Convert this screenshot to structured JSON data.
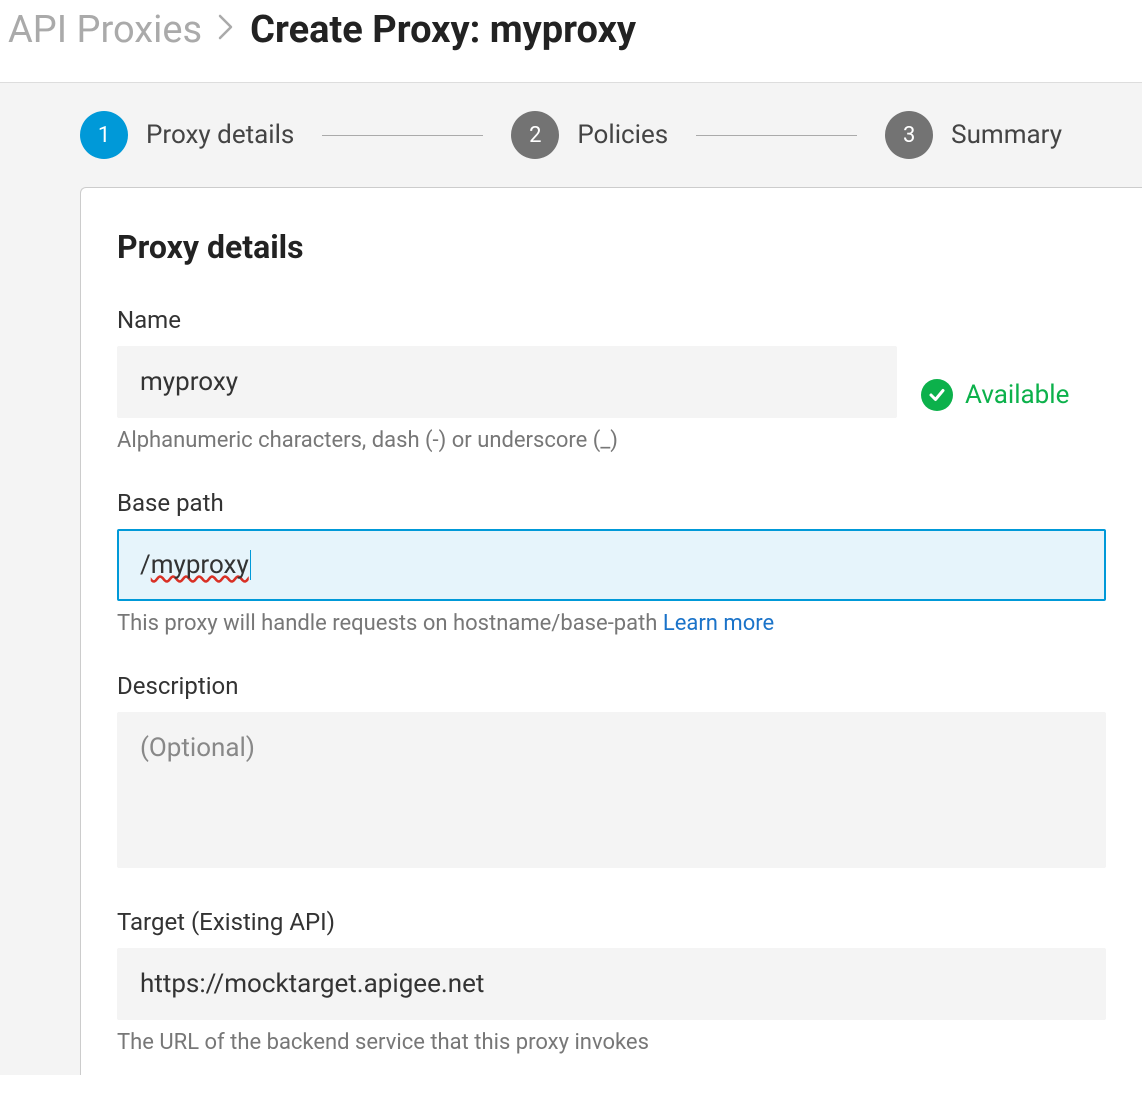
{
  "breadcrumb": {
    "parent": "API Proxies",
    "current": "Create Proxy: myproxy"
  },
  "stepper": {
    "steps": [
      {
        "num": "1",
        "label": "Proxy details",
        "active": true
      },
      {
        "num": "2",
        "label": "Policies",
        "active": false
      },
      {
        "num": "3",
        "label": "Summary",
        "active": false
      }
    ]
  },
  "panel": {
    "title": "Proxy details",
    "fields": {
      "name": {
        "label": "Name",
        "value": "myproxy",
        "help": "Alphanumeric characters, dash (-) or underscore (_)",
        "availability": "Available"
      },
      "basepath": {
        "label": "Base path",
        "value": "/myproxy",
        "help": "This proxy will handle requests on hostname/base-path ",
        "learn_more": "Learn more"
      },
      "description": {
        "label": "Description",
        "placeholder": "(Optional)",
        "value": ""
      },
      "target": {
        "label": "Target (Existing API)",
        "value": "https://mocktarget.apigee.net",
        "help": "The URL of the backend service that this proxy invokes"
      }
    }
  }
}
